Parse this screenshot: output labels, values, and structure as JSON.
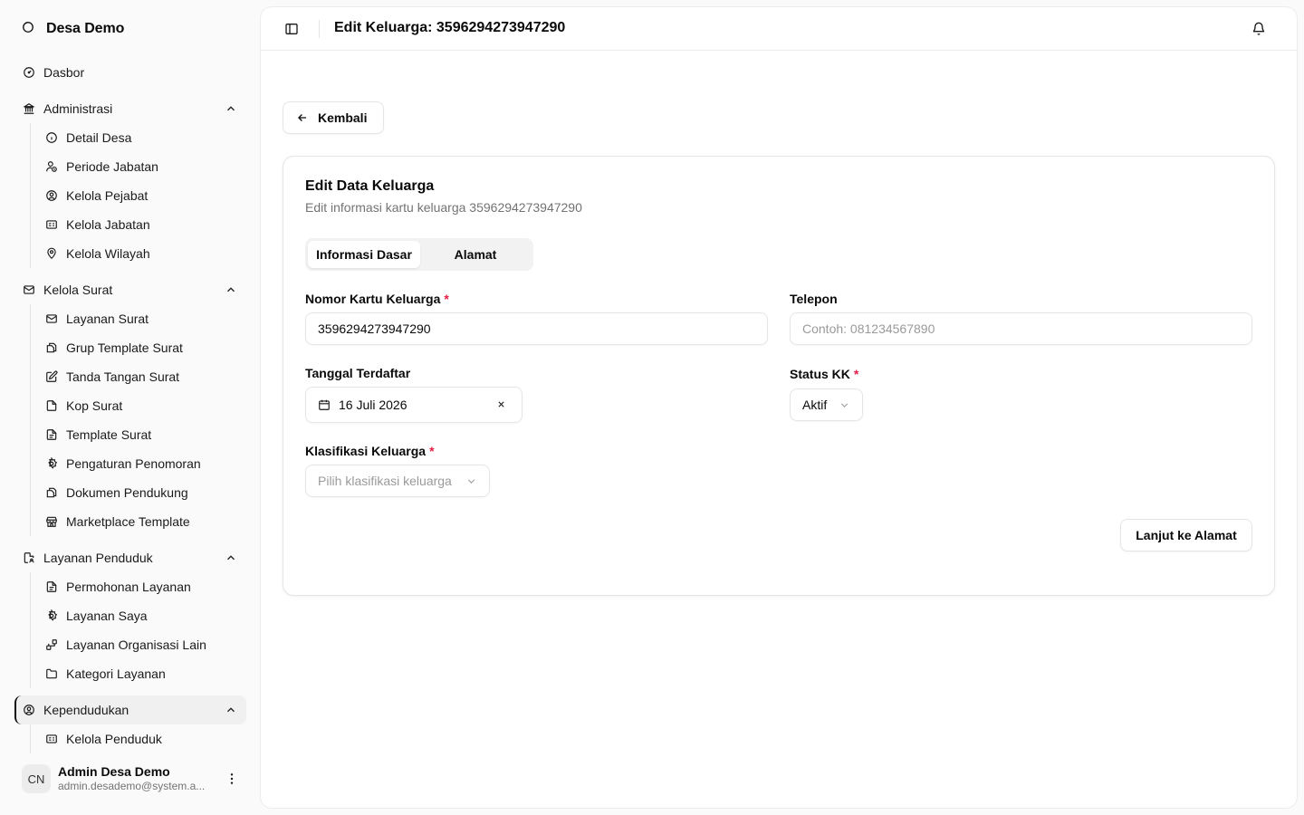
{
  "brand": {
    "name": "Desa Demo",
    "icon": "circle-logo-icon"
  },
  "sidebar": {
    "top_item": {
      "label": "Dasbor",
      "icon": "gauge-icon"
    },
    "groups": [
      {
        "label": "Administrasi",
        "icon": "landmark-icon",
        "items": [
          {
            "label": "Detail Desa",
            "icon": "info-icon"
          },
          {
            "label": "Periode Jabatan",
            "icon": "user-clock-icon"
          },
          {
            "label": "Kelola Pejabat",
            "icon": "user-circle-icon"
          },
          {
            "label": "Kelola Jabatan",
            "icon": "id-card-icon"
          },
          {
            "label": "Kelola Wilayah",
            "icon": "map-pin-icon"
          }
        ]
      },
      {
        "label": "Kelola Surat",
        "icon": "mail-icon",
        "items": [
          {
            "label": "Layanan Surat",
            "icon": "mail-icon"
          },
          {
            "label": "Grup Template Surat",
            "icon": "files-icon"
          },
          {
            "label": "Tanda Tangan Surat",
            "icon": "pen-square-icon"
          },
          {
            "label": "Kop Surat",
            "icon": "file-icon"
          },
          {
            "label": "Template Surat",
            "icon": "file-text-icon"
          },
          {
            "label": "Pengaturan Penomoran",
            "icon": "settings-icon"
          },
          {
            "label": "Dokumen Pendukung",
            "icon": "files-icon"
          },
          {
            "label": "Marketplace Template",
            "icon": "store-icon"
          }
        ]
      },
      {
        "label": "Layanan Penduduk",
        "icon": "file-user-icon",
        "items": [
          {
            "label": "Permohonan Layanan",
            "icon": "file-text-icon"
          },
          {
            "label": "Layanan Saya",
            "icon": "settings-icon"
          },
          {
            "label": "Layanan Organisasi Lain",
            "icon": "network-icon"
          },
          {
            "label": "Kategori Layanan",
            "icon": "folder-icon"
          }
        ]
      },
      {
        "label": "Kependudukan",
        "icon": "user-circle-icon",
        "items": [
          {
            "label": "Kelola Penduduk",
            "icon": "id-card-icon"
          }
        ]
      }
    ]
  },
  "user": {
    "initials": "CN",
    "name": "Admin Desa Demo",
    "email": "admin.desademo@system.a..."
  },
  "header": {
    "title": "Edit Keluarga: 3596294273947290"
  },
  "back_button": {
    "label": "Kembali"
  },
  "card": {
    "title": "Edit Data Keluarga",
    "description": "Edit informasi kartu keluarga 3596294273947290"
  },
  "tabs": [
    {
      "label": "Informasi Dasar",
      "active": true
    },
    {
      "label": "Alamat",
      "active": false
    }
  ],
  "form": {
    "nomor_kk": {
      "label": "Nomor Kartu Keluarga",
      "required": "*",
      "value": "3596294273947290"
    },
    "telepon": {
      "label": "Telepon",
      "placeholder": "Contoh: 081234567890"
    },
    "tanggal": {
      "label": "Tanggal Terdaftar",
      "value": "16 Juli 2026"
    },
    "status": {
      "label": "Status KK",
      "required": "*",
      "value": "Aktif"
    },
    "klasifikasi": {
      "label": "Klasifikasi Keluarga",
      "required": "*",
      "placeholder": "Pilih klasifikasi keluarga"
    }
  },
  "next_button": {
    "label": "Lanjut ke Alamat"
  },
  "colors": {
    "accent": "#0a0a0a",
    "required": "#e11d48",
    "muted": "#737373",
    "border": "#e5e5e5"
  }
}
